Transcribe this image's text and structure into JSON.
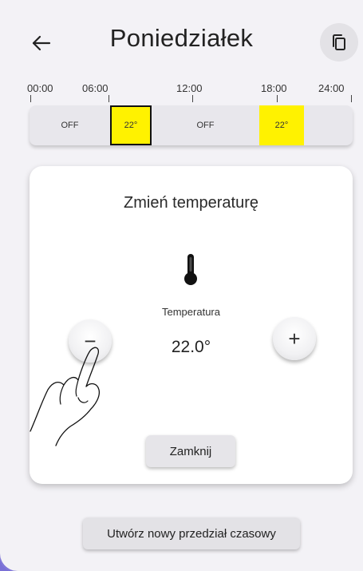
{
  "header": {
    "title": "Poniedziałek",
    "back_icon": "arrow-left-icon",
    "copy_icon": "copy-icon"
  },
  "timeline": {
    "ticks": [
      "00:00",
      "06:00",
      "12:00",
      "18:00",
      "24:00"
    ],
    "segments": [
      {
        "label": "OFF",
        "state": "off"
      },
      {
        "label": "22°",
        "state": "heat",
        "selected": true
      },
      {
        "label": "OFF",
        "state": "off"
      },
      {
        "label": "22°",
        "state": "heat"
      },
      {
        "label": "",
        "state": "off"
      }
    ],
    "colors": {
      "heat": "#fff200",
      "off": "#e8e7ec",
      "selected_border": "#111111"
    }
  },
  "dialog": {
    "title": "Zmień temperaturę",
    "icon": "thermometer-icon",
    "temperature_label": "Temperatura",
    "temperature_value": "22.0°",
    "minus_label": "−",
    "plus_label": "+",
    "close_label": "Zamknij"
  },
  "footer": {
    "new_interval_label": "Utwórz nowy przedział czasowy"
  },
  "colors": {
    "accent": "#7a70d6",
    "background": "#f3f2f6",
    "card": "#ffffff"
  }
}
